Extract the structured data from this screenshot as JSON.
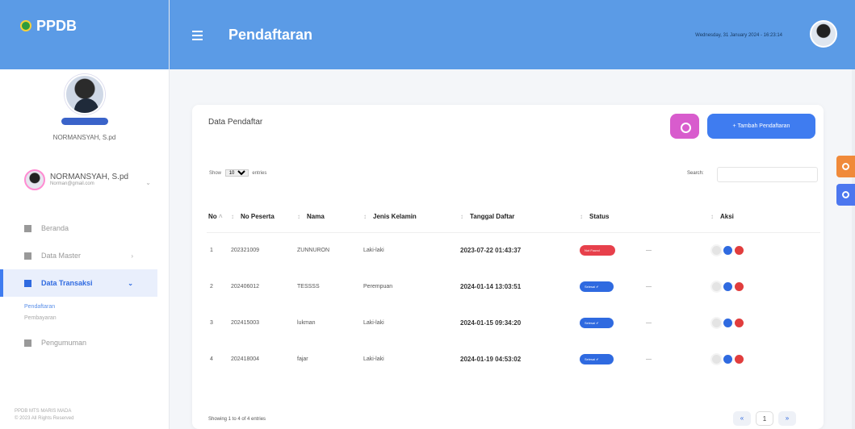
{
  "brand": {
    "name": "PPDB"
  },
  "sidebar": {
    "profile_name": "NORMANSYAH, S.pd",
    "user_name": "NORMANSYAH, S.pd",
    "user_email": "Norman@gmail.com",
    "menu": [
      {
        "label": "Beranda",
        "icon": "home-icon"
      },
      {
        "label": "Data Master",
        "icon": "database-icon"
      },
      {
        "label": "Data Transaksi",
        "icon": "file-icon",
        "active": true
      },
      {
        "label": "Pengumuman",
        "icon": "document-icon"
      }
    ],
    "submenu": [
      "Pendaftaran",
      "Pembayaran"
    ],
    "footer_line1": "PPDB MTS MARIS MADA",
    "footer_line2": "© 2023 All Rights Reserved"
  },
  "topbar": {
    "title": "Pendaftaran",
    "datetime": "Wednesday, 31 January 2024 - 16:23:14"
  },
  "card": {
    "title": "Data Pendaftar",
    "add_button": "+ Tambah Pendaftaran",
    "show_label": "Show",
    "show_value": "10",
    "entries_label": "entries",
    "search_label": "Search:",
    "search_value": "",
    "info": "Showing 1 to 4 of 4 entries",
    "pagination": [
      "«",
      "1",
      "»"
    ]
  },
  "table": {
    "headers": [
      "No",
      "No Peserta",
      "Nama",
      "Jenis Kelamin",
      "Tanggal Daftar",
      "Status",
      "",
      "Aksi"
    ],
    "rows": [
      {
        "no": "1",
        "peserta": "202321009",
        "nama": "ZUNNURON",
        "jk": "Laki-laki",
        "tanggal": "2023-07-22 01:43:37",
        "status": "Not Found",
        "status_color": "red",
        "dash": "—"
      },
      {
        "no": "2",
        "peserta": "202406012",
        "nama": "TESSSS",
        "jk": "Perempuan",
        "tanggal": "2024-01-14 13:03:51",
        "status": "Selesai ✔",
        "status_color": "blue",
        "dash": "—"
      },
      {
        "no": "3",
        "peserta": "202415003",
        "nama": "lukman",
        "jk": "Laki-laki",
        "tanggal": "2024-01-15 09:34:20",
        "status": "Selesai ✔",
        "status_color": "blue",
        "dash": "—"
      },
      {
        "no": "4",
        "peserta": "202418004",
        "nama": "fajar",
        "jk": "Laki-laki",
        "tanggal": "2024-01-19 04:53:02",
        "status": "Selesai ✔",
        "status_color": "blue",
        "dash": "—"
      }
    ]
  },
  "colors": {
    "primary": "#5b9be6",
    "accent_blue": "#3f7cf0",
    "pink": "#d85ccd",
    "danger": "#e7404b",
    "orange": "#f08a3a"
  }
}
